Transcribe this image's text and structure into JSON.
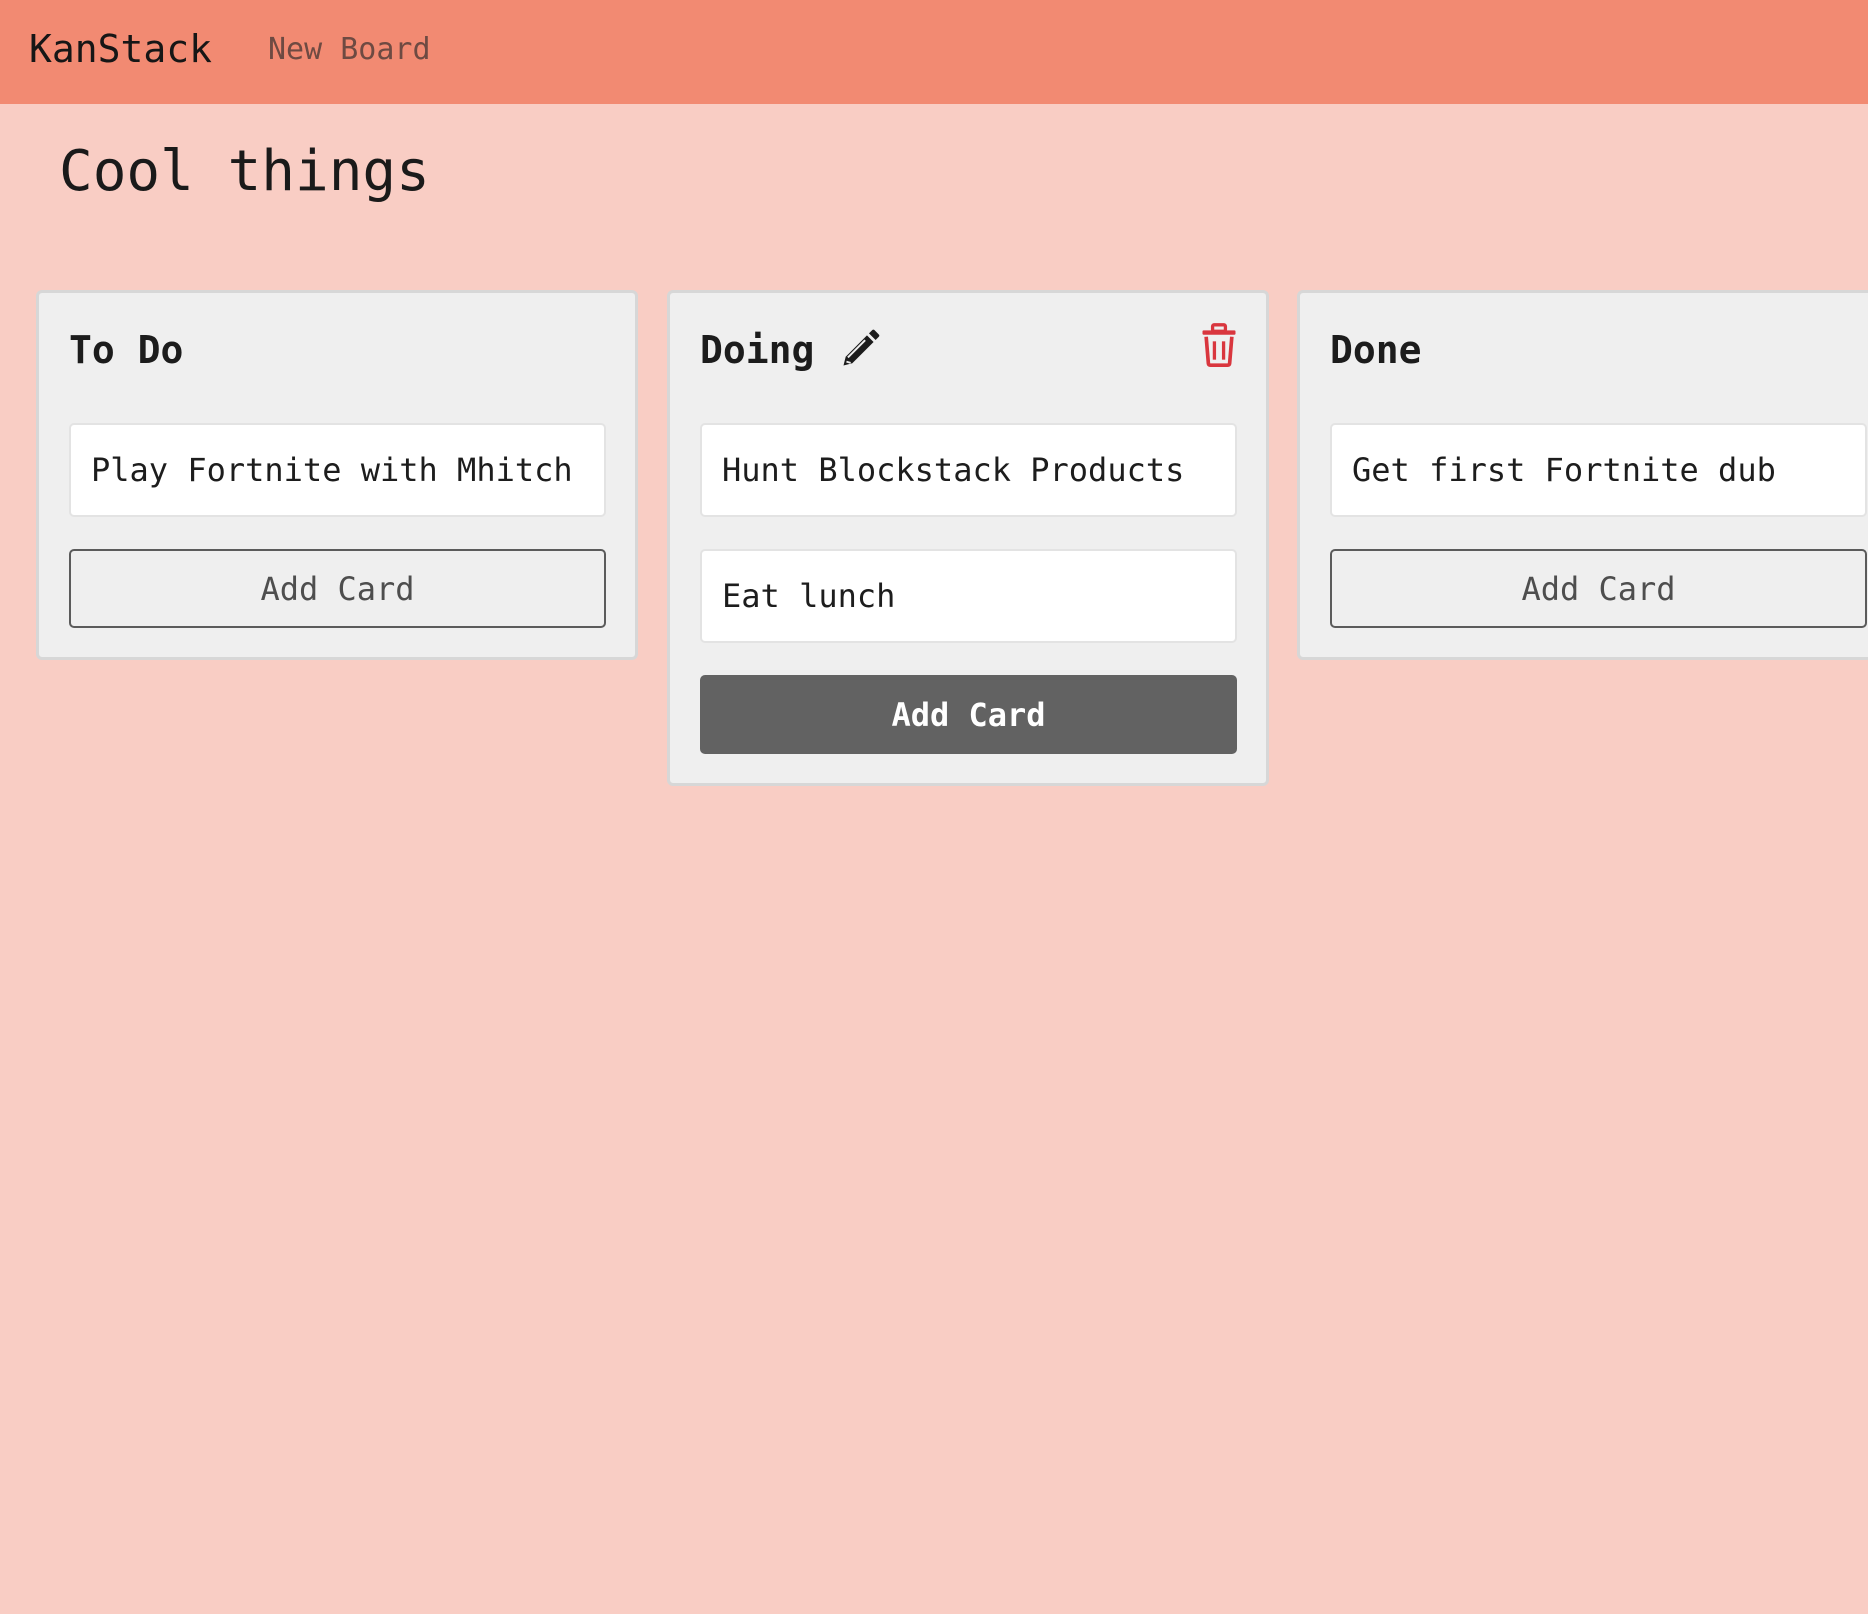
{
  "app": {
    "brand": "KanStack",
    "nav_new_board": "New Board"
  },
  "board": {
    "title": "Cool things",
    "lists": [
      {
        "title": "To Do",
        "cards": [
          "Play Fortnite with Mhitch"
        ],
        "add_card_label": "Add Card"
      },
      {
        "title": "Doing",
        "cards": [
          "Hunt Blockstack Products",
          "Eat lunch"
        ],
        "add_card_label": "Add Card",
        "edit_icon": "pencil-icon",
        "delete_icon": "trash-icon"
      },
      {
        "title": "Done",
        "cards": [
          "Get first Fortnite dub"
        ],
        "add_card_label": "Add Card"
      }
    ]
  },
  "colors": {
    "navbar": "#f28a72",
    "background": "#f9cdc4",
    "list_bg": "#efefef",
    "delete": "#d9363e",
    "button_active": "#626262"
  }
}
